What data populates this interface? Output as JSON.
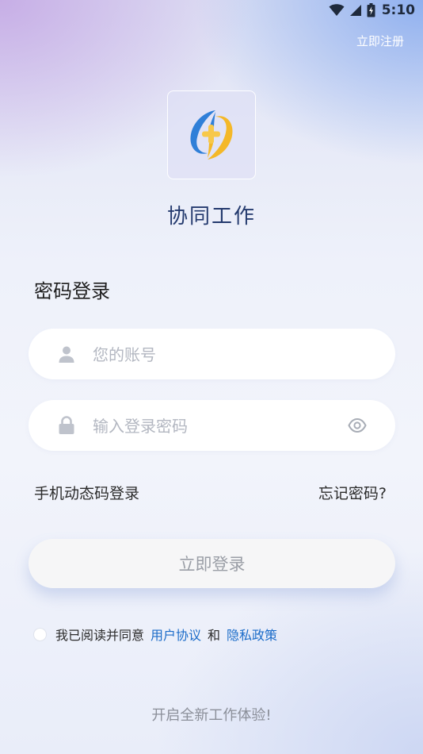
{
  "status_bar": {
    "time": "5:10",
    "icons": [
      "wifi-icon",
      "signal-icon",
      "battery-icon"
    ]
  },
  "header": {
    "register_label": "立即注册"
  },
  "app": {
    "name": "协同工作",
    "logo": "app-logo-icon"
  },
  "login": {
    "title": "密码登录",
    "account_placeholder": "您的账号",
    "password_placeholder": "输入登录密码",
    "sms_login_label": "手机动态码登录",
    "forgot_label": "忘记密码?",
    "submit_label": "立即登录"
  },
  "agreement": {
    "prefix": "我已阅读并同意",
    "user_agreement": "用户协议",
    "and": "和",
    "privacy_policy": "隐私政策"
  },
  "footer": {
    "tagline": "开启全新工作体验!"
  },
  "colors": {
    "brand_blue": "#1b6cc9",
    "logo_orange": "#f4b828",
    "logo_blue": "#2f7fd8",
    "title_navy": "#243a6e"
  }
}
